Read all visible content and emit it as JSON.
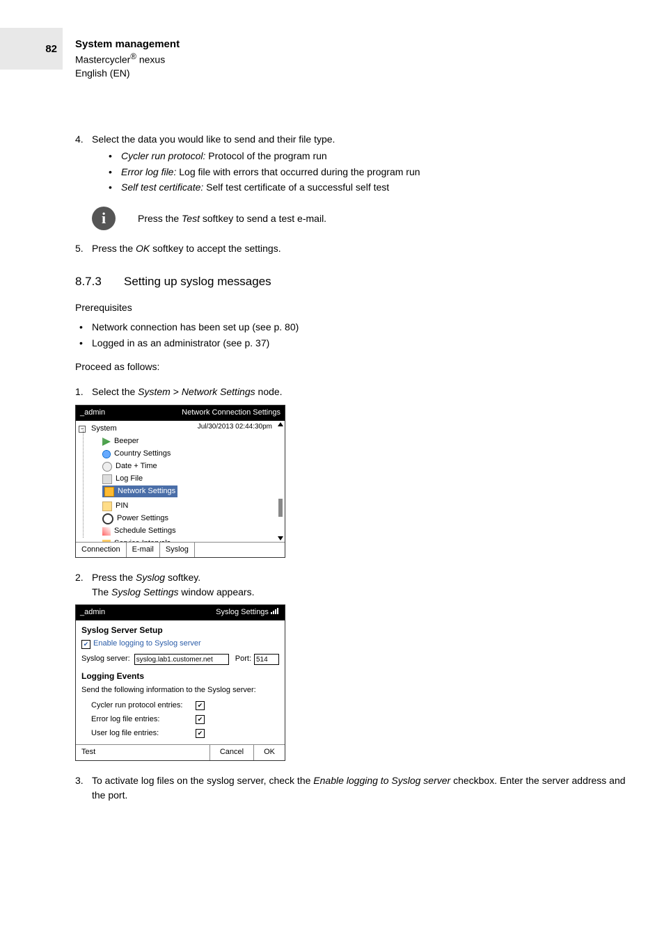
{
  "page_number": "82",
  "header": {
    "line1": "System management",
    "line2_pre": "Mastercycler",
    "line2_reg": "®",
    "line2_post": " nexus",
    "line3": "English (EN)"
  },
  "step4": {
    "num": "4.",
    "text": "Select the data you would like to send and their file type.",
    "items": [
      {
        "term": "Cycler run protocol:",
        "desc": " Protocol of the program run"
      },
      {
        "term": "Error log file:",
        "desc": " Log file with errors that occurred during the program run"
      },
      {
        "term": "Self test certificate:",
        "desc": " Self test certificate of a successful self test"
      }
    ]
  },
  "info_note": {
    "pre": "Press the ",
    "ital": "Test",
    "post": " softkey to send a test e-mail."
  },
  "step5": {
    "num": "5.",
    "pre": "Press the ",
    "ital": "OK",
    "post": " softkey to accept the settings."
  },
  "section": {
    "num": "8.7.3",
    "title": "Setting up syslog messages"
  },
  "prereq_label": "Prerequisites",
  "prereqs": [
    "Network connection has been set up (see p. 80)",
    "Logged in as an administrator (see p. 37)"
  ],
  "proceed": "Proceed as follows:",
  "step1": {
    "num": "1.",
    "pre": "Select the ",
    "ital1": "System",
    "mid": " > ",
    "ital2": "Network Settings",
    "post": " node."
  },
  "shot1": {
    "title_left": "_admin",
    "title_right": "Network Connection Settings",
    "date": "Jul/30/2013 02:44:30pm",
    "root": "System",
    "items": [
      "Beeper",
      "Country Settings",
      "Date + Time",
      "Log File",
      "Network Settings",
      "PIN",
      "Power Settings",
      "Schedule Settings",
      "Service Intervals"
    ],
    "selected_index": 4,
    "softkeys": [
      "Connection",
      "E-mail",
      "Syslog"
    ]
  },
  "step2": {
    "num": "2.",
    "pre": "Press the ",
    "ital": "Syslog",
    "post": " softkey.",
    "line2_pre": "The ",
    "line2_ital": "Syslog Settings",
    "line2_post": " window appears."
  },
  "shot2": {
    "title_left": "_admin",
    "title_right": "Syslog Settings",
    "h1": "Syslog Server Setup",
    "enable_label": "Enable logging to Syslog server",
    "server_label": "Syslog server:",
    "server_value": "syslog.lab1.customer.net",
    "port_label": "Port:",
    "port_value": "514",
    "h2": "Logging Events",
    "send_line": "Send the following information to the Syslog server:",
    "opts": [
      "Cycler run protocol entries:",
      "Error log file entries:",
      "User log file entries:"
    ],
    "keys": {
      "left": "Test",
      "mid": "Cancel",
      "right": "OK"
    }
  },
  "step3": {
    "num": "3.",
    "pre": "To activate log files on the syslog server, check the ",
    "ital": "Enable logging to Syslog server",
    "post": " checkbox. Enter the server address and the port."
  }
}
